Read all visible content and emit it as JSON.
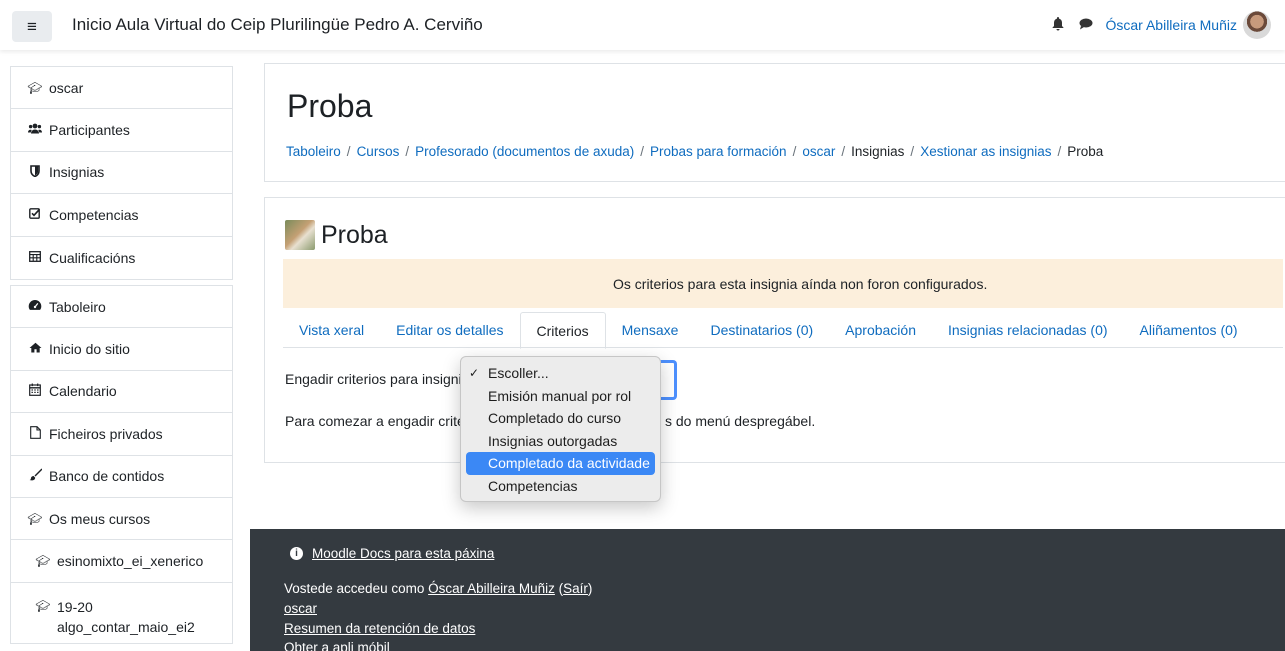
{
  "navbar": {
    "toggle_icon": "≡",
    "site_name": "Inicio Aula Virtual do Ceip Plurilingüe Pedro A. Cerviño",
    "user_name": "Óscar Abilleira Muñiz"
  },
  "sidebar": {
    "group1": [
      {
        "label": "oscar",
        "icon": "graduation-cap-icon"
      },
      {
        "label": "Participantes",
        "icon": "users-icon"
      },
      {
        "label": "Insignias",
        "icon": "shield-icon"
      },
      {
        "label": "Competencias",
        "icon": "checkbox-icon"
      },
      {
        "label": "Cualificacións",
        "icon": "table-icon"
      }
    ],
    "group2": [
      {
        "label": "Taboleiro",
        "icon": "dashboard-icon"
      },
      {
        "label": "Inicio do sitio",
        "icon": "home-icon"
      },
      {
        "label": "Calendario",
        "icon": "calendar-icon"
      },
      {
        "label": "Ficheiros privados",
        "icon": "file-icon"
      },
      {
        "label": "Banco de contidos",
        "icon": "brush-icon"
      },
      {
        "label": "Os meus cursos",
        "icon": "graduation-cap-icon"
      },
      {
        "label": "esinomixto_ei_xenerico",
        "icon": "graduation-cap-icon"
      },
      {
        "label_line1": "19-20",
        "label_line2": "algo_contar_maio_ei2",
        "icon": "graduation-cap-icon"
      }
    ]
  },
  "header": {
    "title": "Proba",
    "breadcrumb": [
      "Taboleiro",
      "Cursos",
      "Profesorado (documentos de axuda)",
      "Probas para formación",
      "oscar",
      "Insignias",
      "Xestionar as insignias",
      "Proba"
    ]
  },
  "badge": {
    "title": "Proba",
    "alert": "Os criterios para esta insignia aínda non foron configurados.",
    "tabs": [
      "Vista xeral",
      "Editar os detalles",
      "Criterios",
      "Mensaxe",
      "Destinatarios (0)",
      "Aprobación",
      "Insignias relacionadas (0)",
      "Aliñamentos (0)"
    ],
    "active_tab": "Criterios",
    "criteria_label": "Engadir criterios para insignia",
    "help_text_start": "Para comezar a engadir crite",
    "help_text_end": "s do menú despregábel."
  },
  "dropdown": {
    "options": [
      "Escoller...",
      "Emisión manual por rol",
      "Completado do curso",
      "Insignias outorgadas",
      "Completado da actividade",
      "Competencias"
    ],
    "checked": "Escoller...",
    "highlighted": "Completado da actividade"
  },
  "footer": {
    "docs_link": "Moodle Docs para esta páxina",
    "logged_in_prefix": "Vostede accedeu como ",
    "logged_in_user": "Óscar Abilleira Muñiz",
    "logout": "Saír",
    "course_link": "oscar",
    "data_retention": "Resumen da retención de datos",
    "mobile_app": "Obter a apli móbil"
  }
}
